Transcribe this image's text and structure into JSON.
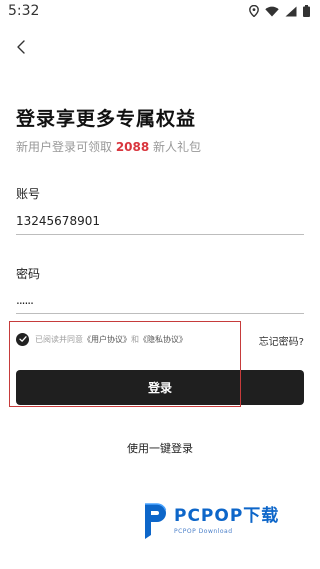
{
  "status_bar": {
    "time": "5:32"
  },
  "header": {
    "back_icon": "chevron-left-icon"
  },
  "title": "登录享更多专属权益",
  "subtitle": {
    "prefix": "新用户登录可领取 ",
    "amount": "2088",
    "suffix": " 新人礼包"
  },
  "account": {
    "label": "账号",
    "value": "13245678901"
  },
  "password": {
    "label": "密码",
    "value": "......"
  },
  "agreement": {
    "checked": true,
    "prefix": "已阅读并同意",
    "user_agreement": "《用户协议》",
    "and": "和",
    "privacy_agreement": "《隐私协议》"
  },
  "forgot_password": "忘记密码?",
  "login_button": "登录",
  "one_click_login": "使用一键登录",
  "watermark": {
    "brand": "PCPOP下载",
    "sub": "PCPOP Download"
  },
  "colors": {
    "accent_red": "#d9363e",
    "button_bg": "#1f1f1f",
    "watermark_blue": "#0d66c9",
    "annotation_red": "#c63b3b"
  }
}
